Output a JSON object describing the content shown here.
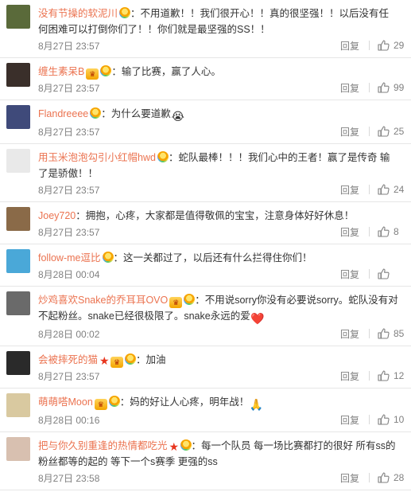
{
  "labels": {
    "reply": "回复"
  },
  "colors": {
    "username": "#eb7350",
    "meta": "#808080",
    "divider": "#e6e6e6"
  },
  "comments": [
    {
      "user": "没有节操的软泥川",
      "badges": [
        "bulb"
      ],
      "text": "：不用道歉！！我们很开心！！真的很坚强！！以后没有任何困难可以打倒你们了！！你们就是最坚强的SS！！",
      "emoji": "",
      "time": "8月27日 23:57",
      "likes": "29",
      "avatar_color": "#5a6a3a"
    },
    {
      "user": "缠生素呆B",
      "badges": [
        "vip",
        "bulb"
      ],
      "text": "：输了比赛，赢了人心。",
      "emoji": "",
      "time": "8月27日 23:57",
      "likes": "99",
      "avatar_color": "#3a2f2a"
    },
    {
      "user": "Flandreeee",
      "badges": [
        "bulb"
      ],
      "text": "：为什么要道歉",
      "emoji": "😭",
      "time": "8月27日 23:57",
      "likes": "25",
      "avatar_color": "#3f4a7a"
    },
    {
      "user": "用玉米泡泡勾引小红帽hwd",
      "badges": [
        "bulb"
      ],
      "text": "：蛇队最棒！！！我们心中的王者！赢了是传奇 输了是骄傲！！",
      "emoji": "",
      "time": "8月27日 23:57",
      "likes": "24",
      "avatar_color": "#e9e9e9"
    },
    {
      "user": "Joey720",
      "badges": [],
      "text": "：拥抱，心疼，大家都是值得敬佩的宝宝，注意身体好好休息！",
      "emoji": "",
      "time": "8月27日 23:57",
      "likes": "8",
      "avatar_color": "#8a6a48"
    },
    {
      "user": "follow-me逗比",
      "badges": [
        "bulb"
      ],
      "text": "：这一关都过了，以后还有什么拦得住你们！",
      "emoji": "",
      "time": "8月28日 00:04",
      "likes": "",
      "avatar_color": "#4aa8d8"
    },
    {
      "user": "炒鸡喜欢Snake的乔耳耳OVO",
      "badges": [
        "vip",
        "bulb"
      ],
      "text": "：不用说sorry你没有必要说sorry。蛇队没有对不起粉丝。snake已经很极限了。snake永远的爱",
      "emoji": "❤️",
      "time": "8月28日 00:02",
      "likes": "85",
      "avatar_color": "#6a6a6a"
    },
    {
      "user": "会被摔死的猫",
      "badges": [
        "star",
        "vip",
        "bulb"
      ],
      "text": "：加油",
      "emoji": "",
      "time": "8月27日 23:57",
      "likes": "12",
      "avatar_color": "#2a2a2a"
    },
    {
      "user": "萌萌嗒Moon",
      "badges": [
        "vip",
        "bulb"
      ],
      "text": "：妈的好让人心疼，明年战！",
      "emoji": "🙏",
      "time": "8月28日 00:16",
      "likes": "10",
      "avatar_color": "#d9c9a0"
    },
    {
      "user": "把与你久别重逢的热情都吃光",
      "badges": [
        "star",
        "bulb"
      ],
      "text": "：每一个队员 每一场比赛都打的很好 所有ss的粉丝都等的起的 等下一个s赛季 更强的ss",
      "emoji": "",
      "time": "8月27日 23:58",
      "likes": "28",
      "avatar_color": "#d8c0b0"
    }
  ]
}
